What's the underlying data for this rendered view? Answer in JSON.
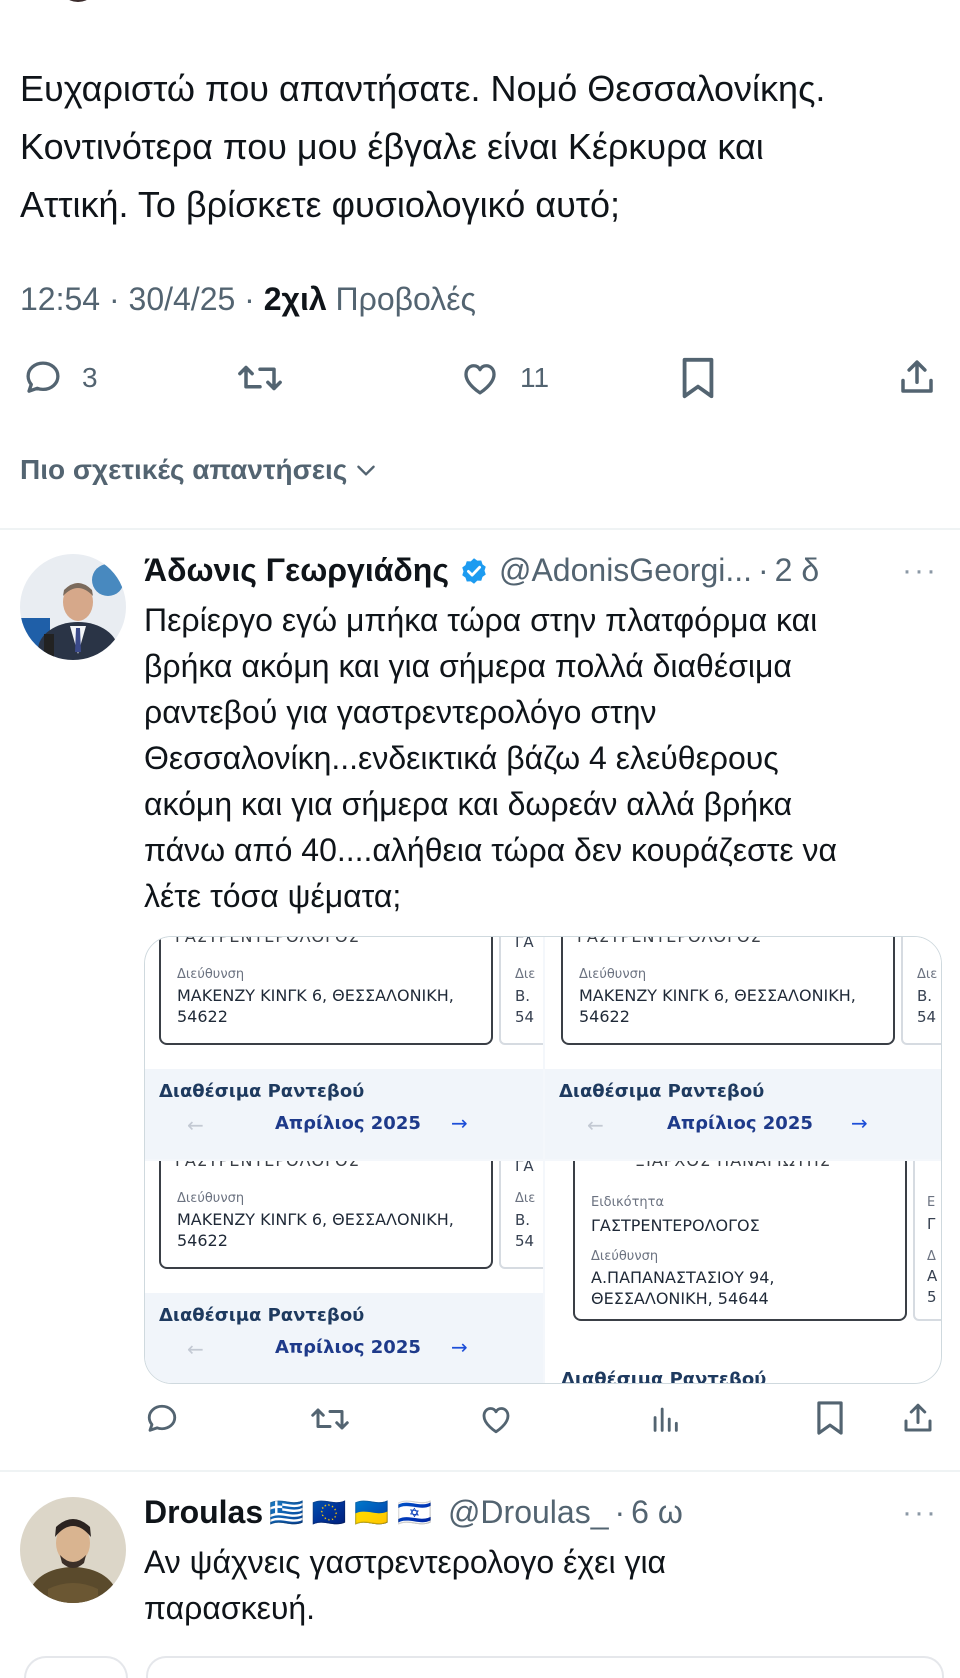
{
  "main_tweet": {
    "lines": [
      "Ευχαριστώ που απαντήσατε. Νομό Θεσσαλονίκης.",
      "Κοντινότερα που μου έβγαλε είναι Κέρκυρα και",
      "Αττική. Το βρίσκετε φυσιολογικό αυτό;"
    ],
    "time": "12:54",
    "date": "30/4/25",
    "views_count": "2χιλ",
    "views_label": "Προβολές",
    "replies": "3",
    "likes": "11"
  },
  "relevant_label": "Πιο σχετικές απαντήσεις",
  "reply1": {
    "name": "Άδωνις Γεωργιάδης",
    "handle": "@AdonisGeorgi...",
    "time": "2 δ",
    "more": "···",
    "lines": [
      "Περίεργο εγώ μπήκα τώρα στην πλατφόρμα και",
      "βρήκα ακόμη και για σήμερα πολλά διαθέσιμα",
      "ραντεβού για γαστρεντερολόγο στην",
      "Θεσσαλονίκη...ενδεικτικά βάζω 4 ελεύθερους",
      "ακόμη και για σήμερα και δωρεάν αλλά βρήκα",
      "πάνω από 40....αλήθεια τώρα δεν κουράζεστε να",
      "λέτε τόσα ψέματα;"
    ],
    "media": {
      "cut_specialty": "ΓΑΣΤΡΕΝΤΕΡΟΛΟΓΟΣ",
      "address_label": "Διεύθυνση",
      "address_line1": "ΜΑΚΕΝΖΥ ΚΙΝΓΚ 6, ΘΕΣΣΑΛΟΝΙΚΗ,",
      "address_line2": "54622",
      "side_cut": "ΓΑ",
      "side_label": "Διε",
      "side_l1": "Β.",
      "side_l2": "54",
      "avail_title": "Διαθέσιμα Ραντεβού",
      "month": "Απρίλιος 2025",
      "arrow_left": "←",
      "arrow_right": "→",
      "q4_cut": "ΞΙΑΡΧΟΣ ΠΑΝΑΓΙΩΤΗΣ",
      "q4_spec_label": "Ειδικότητα",
      "q4_spec": "ΓΑΣΤΡΕΝΤΕΡΟΛΟΓΟΣ",
      "q4_addr1": "Α.ΠΑΠΑΝΑΣΤΑΣΙΟΥ 94,",
      "q4_addr2": "ΘΕΣΣΑΛΟΝΙΚΗ, 54644",
      "q4_side_a": "Ε",
      "q4_side_b": "Γ",
      "q4_side_c": "Δ",
      "q4_side_d": "Α",
      "q4_side_e": "5",
      "q4_bottom_cut": "Διαθέσιμα Ραντεβού"
    }
  },
  "reply2": {
    "name": "Droulas",
    "flags": "🇬🇷 🇪🇺 🇺🇦 🇮🇱",
    "handle": "@Droulas_",
    "time": "6 ω",
    "more": "···",
    "lines": [
      "Αν ψάχνεις γαστρεντερολογο έχει για",
      "παρασκευή."
    ]
  },
  "colors": {
    "text": "#0f1419",
    "secondary": "#536471",
    "verified": "#1d9bf0",
    "divider": "#eff3f4"
  }
}
